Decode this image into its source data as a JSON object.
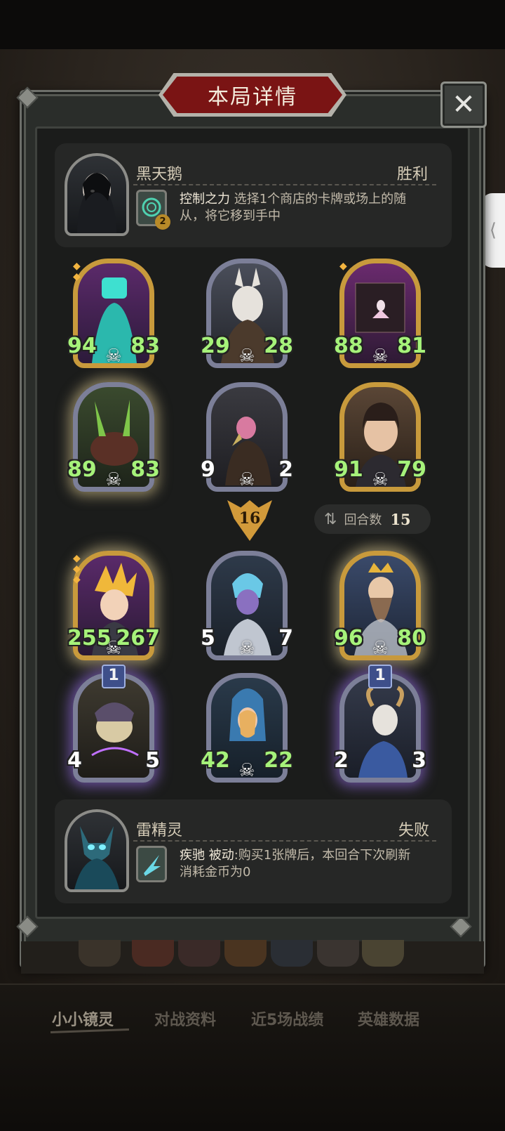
{
  "dialog": {
    "title": "本局详情"
  },
  "top_player": {
    "name": "黑天鹅",
    "result": "胜利",
    "skill_level": "2",
    "skill_name": "控制之力",
    "skill_desc_line1": "选择1个商店的卡牌或场上的随",
    "skill_desc_line2": "从，将它移到手中"
  },
  "top_board": [
    {
      "atk": "94",
      "hp": "83"
    },
    {
      "atk": "29",
      "hp": "28"
    },
    {
      "atk": "88",
      "hp": "81"
    },
    {
      "atk": "89",
      "hp": "83"
    },
    {
      "atk": "9",
      "hp": "2"
    },
    {
      "atk": "91",
      "hp": "79"
    }
  ],
  "round_marker": "16",
  "turns": {
    "label": "回合数",
    "value": "15"
  },
  "bottom_board": [
    {
      "atk": "255",
      "hp": "267"
    },
    {
      "atk": "5",
      "hp": "7"
    },
    {
      "atk": "96",
      "hp": "80"
    },
    {
      "atk": "4",
      "hp": "5",
      "rank": "1"
    },
    {
      "atk": "42",
      "hp": "22"
    },
    {
      "atk": "2",
      "hp": "3",
      "rank": "1"
    }
  ],
  "bottom_player": {
    "name": "雷精灵",
    "result": "失败",
    "skill_name": "疾驰",
    "skill_tag": "被动",
    "skill_desc_line1": ":购买1张牌后，本回合下次刷新",
    "skill_desc_line2": "消耗金币为0"
  },
  "bottom_nav": [
    "小小镜灵",
    "对战资料",
    "近5场战绩",
    "英雄数据"
  ],
  "colors": {
    "buffed_stat": "#a6f27a",
    "base_stat": "#ffffff",
    "title_plate": "#7a1414",
    "gold_frame": "#c89a3c"
  },
  "icons": {
    "close": "close-icon",
    "turns": "swap-arrows-icon",
    "skull": "skull-icon",
    "side_pull": "chevron-left-icon"
  }
}
